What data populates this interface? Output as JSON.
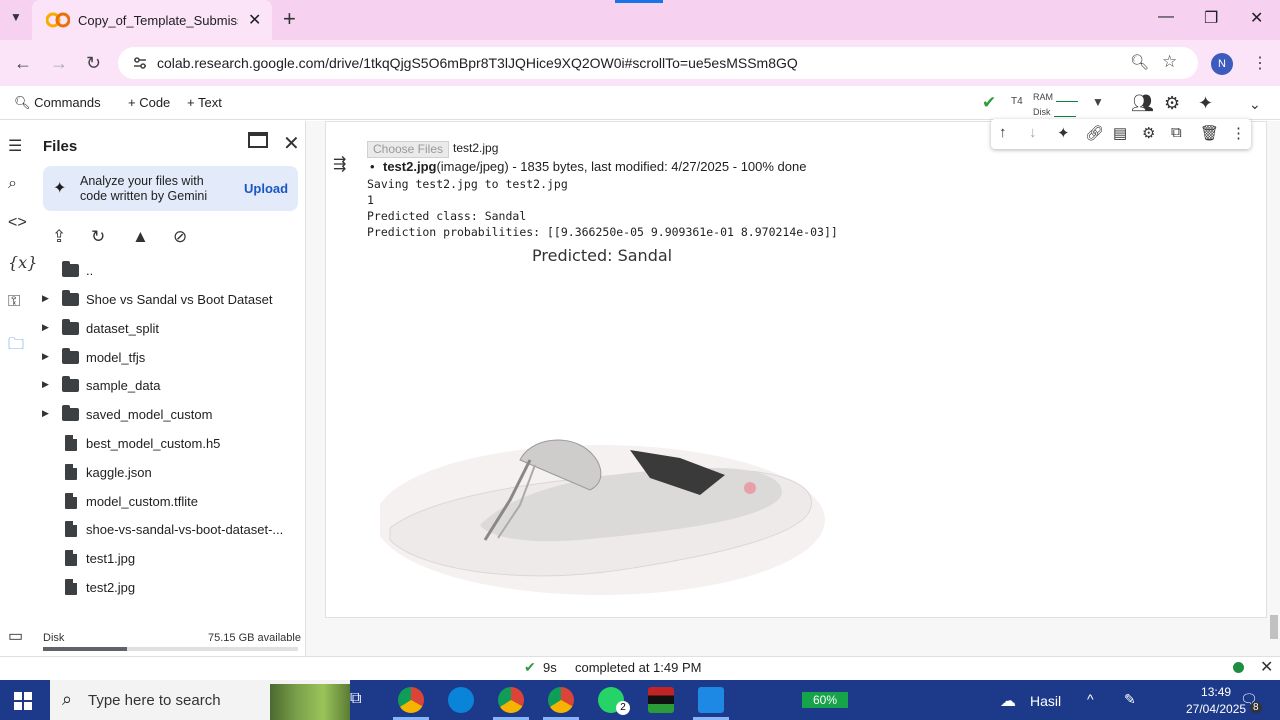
{
  "browser": {
    "tab_title": "Copy_of_Template_Submission",
    "url": "colab.research.google.com/drive/1tkqQjgS5O6mBpr8T3lJQHice9XQ2OW0i#scrollTo=ue5esMSSm8GQ",
    "profile_initial": "N"
  },
  "colab_toolbar": {
    "commands_label": "Commands",
    "code_label": "+ Code",
    "text_label": "+ Text",
    "runtime_type": "T4",
    "ram_label": "RAM",
    "disk_label": "Disk"
  },
  "files_panel": {
    "title": "Files",
    "gemini_text": "Analyze your files with code written by Gemini",
    "upload_label": "Upload",
    "parent_dir": "..",
    "items": [
      {
        "type": "folder",
        "name": "Shoe vs Sandal vs Boot Dataset"
      },
      {
        "type": "folder",
        "name": "dataset_split"
      },
      {
        "type": "folder",
        "name": "model_tfjs"
      },
      {
        "type": "folder",
        "name": "sample_data"
      },
      {
        "type": "folder",
        "name": "saved_model_custom"
      },
      {
        "type": "file",
        "name": "best_model_custom.h5"
      },
      {
        "type": "file",
        "name": "kaggle.json"
      },
      {
        "type": "file",
        "name": "model_custom.tflite"
      },
      {
        "type": "file",
        "name": "shoe-vs-sandal-vs-boot-dataset-..."
      },
      {
        "type": "file",
        "name": "test1.jpg"
      },
      {
        "type": "file",
        "name": "test2.jpg"
      }
    ],
    "disk_label": "Disk",
    "disk_available": "75.15 GB available",
    "disk_used_fraction": 0.33
  },
  "cell_output": {
    "choose_files_label": "Choose Files",
    "chosen_file": "test2.jpg",
    "upload_filename": "test2.jpg",
    "upload_detail": "(image/jpeg) - 1835 bytes, last modified: 4/27/2025 - 100% done",
    "saving_line": "Saving test2.jpg to test2.jpg",
    "index_line": "1",
    "predicted_class_line": "Predicted class: Sandal",
    "probabilities_line": "Prediction probabilities: [[9.366250e-05 9.909361e-01 8.970214e-03]]",
    "plot_title": "Predicted: Sandal"
  },
  "status_bar": {
    "elapsed": "9s",
    "completed": "completed at 1:49 PM"
  },
  "taskbar": {
    "search_placeholder": "Type here to search",
    "whatsapp_badge": "2",
    "battery": "60%",
    "weather": "Hasil",
    "time": "13:49",
    "date": "27/04/2025",
    "notification_count": "8"
  },
  "colors": {
    "tab_bar": "#f6d2f0",
    "address_bar": "#fbe4f7",
    "accent_blue": "#1a73e8",
    "success_green": "#2e9c3f",
    "taskbar": "#1d3a8a"
  }
}
